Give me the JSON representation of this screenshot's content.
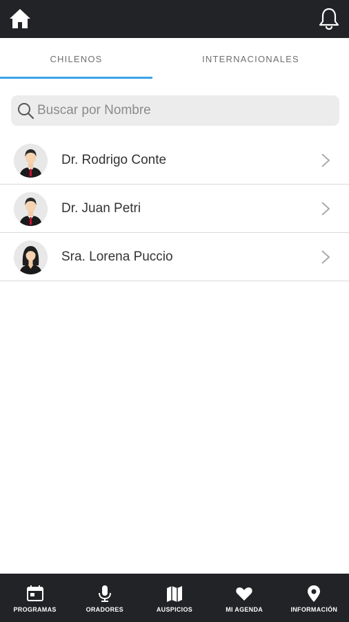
{
  "header": {
    "home_icon": "home-icon",
    "notification_icon": "bell-icon"
  },
  "tabs": [
    {
      "label": "CHILENOS",
      "active": true
    },
    {
      "label": "INTERNACIONALES",
      "active": false
    }
  ],
  "accent_color": "#3aa4e8",
  "search": {
    "placeholder": "Buscar por Nombre",
    "value": ""
  },
  "speakers": [
    {
      "name": "Dr. Rodrigo Conte",
      "avatar": "male-avatar"
    },
    {
      "name": "Dr. Juan Petri",
      "avatar": "male-avatar"
    },
    {
      "name": "Sra. Lorena Puccio",
      "avatar": "female-avatar"
    }
  ],
  "bottom_nav": [
    {
      "label": "PROGRAMAS",
      "icon": "calendar-icon"
    },
    {
      "label": "ORADORES",
      "icon": "microphone-icon"
    },
    {
      "label": "AUSPICIOS",
      "icon": "map-icon"
    },
    {
      "label": "MI AGENDA",
      "icon": "heart-icon"
    },
    {
      "label": "INFORMACIÓN",
      "icon": "location-pin-icon"
    }
  ]
}
